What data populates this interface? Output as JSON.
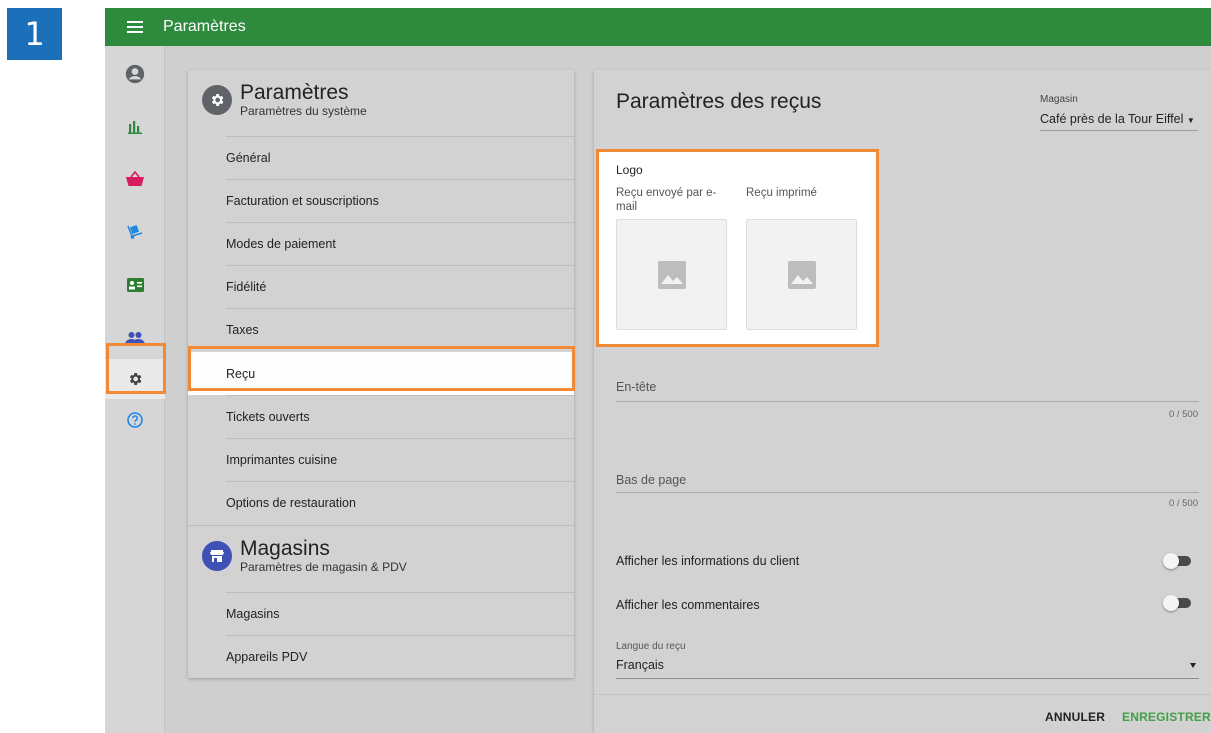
{
  "step_badge": "1",
  "topbar": {
    "title": "Paramètres"
  },
  "rail": {
    "items": [
      {
        "icon": "account-circle-icon",
        "color": "#5f6368"
      },
      {
        "icon": "bar-chart-icon",
        "color": "#2e8b3e"
      },
      {
        "icon": "basket-icon",
        "color": "#d81b60"
      },
      {
        "icon": "dolly-icon",
        "color": "#1e88e5"
      },
      {
        "icon": "id-card-icon",
        "color": "#2e7d32"
      },
      {
        "icon": "people-icon",
        "color": "#3f51b5"
      },
      {
        "icon": "gear-icon",
        "color": "#424242",
        "selected": true
      },
      {
        "icon": "help-icon",
        "color": "#1e88e5"
      }
    ]
  },
  "settings_menu": {
    "system": {
      "title": "Paramètres",
      "subtitle": "Paramètres du système",
      "icon": "gear-icon",
      "icon_color": "#5f6368"
    },
    "items": [
      "Général",
      "Facturation et souscriptions",
      "Modes de paiement",
      "Fidélité",
      "Taxes",
      "Reçu",
      "Tickets ouverts",
      "Imprimantes cuisine",
      "Options de restauration"
    ],
    "active_item": "Reçu",
    "stores": {
      "title": "Magasins",
      "subtitle": "Paramètres de magasin & PDV",
      "icon": "store-icon",
      "icon_color": "#3f51b5"
    },
    "store_items": [
      "Magasins",
      "Appareils PDV"
    ]
  },
  "receipt": {
    "title": "Paramètres des reçus",
    "store_label": "Magasin",
    "store_value": "Café près de la Tour Eiffel",
    "logo_title": "Logo",
    "logo_email_label": "Reçu envoyé par e-mail",
    "logo_print_label": "Reçu imprimé",
    "header_label": "En-tête",
    "header_counter": "0 / 500",
    "footer_label": "Bas de page",
    "footer_counter": "0 / 500",
    "toggle_customer_label": "Afficher les informations du client",
    "toggle_customer_on": false,
    "toggle_comments_label": "Afficher les commentaires",
    "toggle_comments_on": false,
    "language_label": "Langue du reçu",
    "language_value": "Français",
    "cancel_label": "ANNULER",
    "save_label": "ENREGISTRER"
  },
  "colors": {
    "topbar": "#2e8b3e",
    "highlight": "#f08a36",
    "save": "#43a047",
    "step_badge": "#1b70b9"
  }
}
